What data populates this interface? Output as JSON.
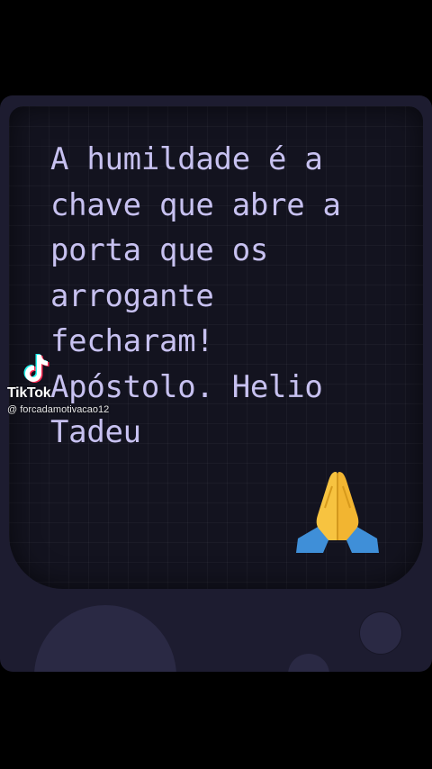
{
  "quote": {
    "text": "A humildade é a\nchave que abre a\nporta que os\narrogante\nfecharam!\nApóstolo. Helio\nTadeu"
  },
  "emoji": {
    "icon": "folded-hands-icon",
    "glyph": "🙏"
  },
  "watermark": {
    "brand": "TikTok",
    "username": "@ forcadamotivacao12",
    "icon": "tiktok-logo-icon"
  },
  "colors": {
    "background": "#000000",
    "frame": "#1d1c30",
    "screen": "#13131f",
    "quote_text": "#c7c1f0"
  }
}
